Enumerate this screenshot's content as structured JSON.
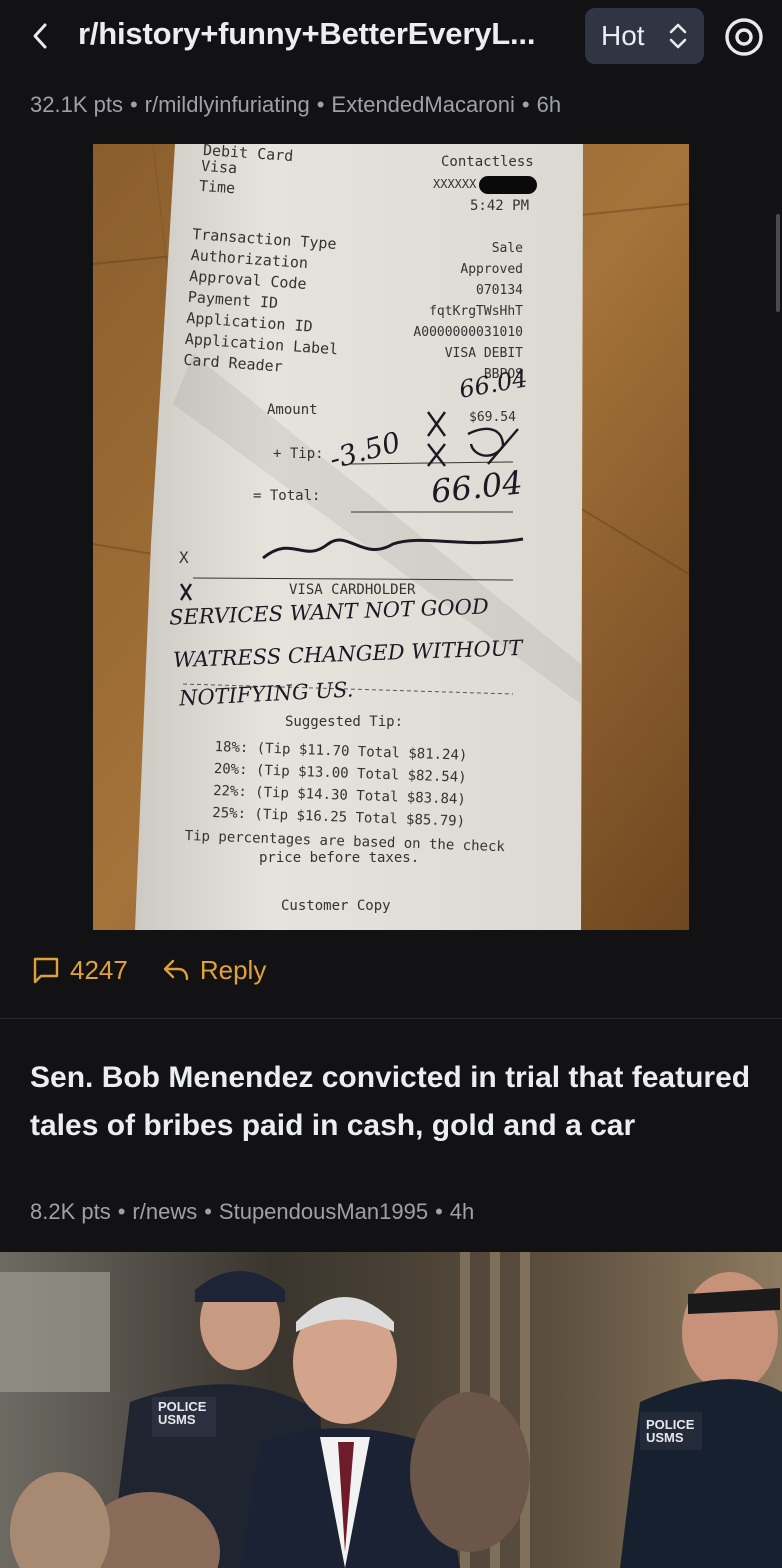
{
  "header": {
    "title": "r/history+funny+BetterEveryL...",
    "sort_label": "Hot"
  },
  "post1": {
    "title_fragment": "...",
    "points": "32.1K pts",
    "subreddit": "r/mildlyinfuriating",
    "author": "ExtendedMacaroni",
    "age": "6h",
    "comments": "4247",
    "reply_label": "Reply",
    "receipt": {
      "top_label": "Debit Card",
      "card": "Visa",
      "time_label": "Time",
      "contactless": "Contactless",
      "card_masked": "XXXXXX",
      "time": "5:42 PM",
      "rows": [
        {
          "label": "Transaction Type",
          "value": "Sale"
        },
        {
          "label": "Authorization",
          "value": "Approved"
        },
        {
          "label": "Approval Code",
          "value": "070134"
        },
        {
          "label": "Payment ID",
          "value": "fqtKrgTWsHhT"
        },
        {
          "label": "Application ID",
          "value": "A0000000031010"
        },
        {
          "label": "Application Label",
          "value": "VISA DEBIT"
        },
        {
          "label": "Card Reader",
          "value": "BBPOS"
        }
      ],
      "amount_label": "Amount",
      "amount": "$69.54",
      "amount_handwritten": "66.04",
      "tip_label": "+ Tip:",
      "tip_handwritten": "-3.50",
      "total_label": "= Total:",
      "total_handwritten": "66.04",
      "signature_mark": "X",
      "cardholder": "VISA CARDHOLDER",
      "note_line1": "SERVICES WANT NOT GOOD",
      "note_line2": "WATRESS CHANGED WITHOUT",
      "note_line3": "NOTIFYING US.",
      "suggested_label": "Suggested Tip:",
      "suggested": [
        "18%: (Tip $11.70  Total $81.24)",
        "20%: (Tip $13.00  Total $82.54)",
        "22%: (Tip $14.30  Total $83.84)",
        "25%: (Tip $16.25  Total $85.79)"
      ],
      "footnote_line1": "Tip percentages are based on the check",
      "footnote_line2": "price before taxes.",
      "copy_label": "Customer Copy"
    }
  },
  "post2": {
    "title": "Sen. Bob Menendez convicted in trial that featured tales of bribes paid in cash, gold and a car",
    "points": "8.2K pts",
    "subreddit": "r/news",
    "author": "StupendousMan1995",
    "age": "4h",
    "photo_badge_left": "POLICE USMS",
    "photo_badge_right": "POLICE USMS"
  },
  "colors": {
    "background": "#121214",
    "accent": "#e0a13a",
    "meta": "#9ea0aa",
    "sort_bg": "#2f3543"
  }
}
